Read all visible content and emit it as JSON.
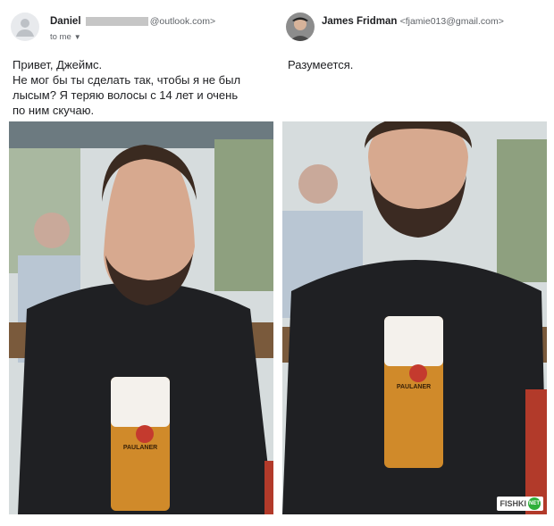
{
  "left": {
    "sender_name": "Daniel",
    "sender_email_domain": "@outlook.com>",
    "recipient": "to me",
    "message_lines": [
      "Привет, Джеймс.",
      "Не мог бы ты сделать так, чтобы я не был",
      "лысым? Я теряю волосы с 14 лет и очень",
      "по ним скучаю."
    ],
    "photo_text": "PAULANER"
  },
  "right": {
    "sender_name": "James Fridman",
    "sender_email": "<fjamie013@gmail.com>",
    "message": "Разумеется.",
    "photo_text": "PAULANER"
  },
  "watermark": {
    "text": "FISHKI",
    "badge": "NET",
    "color": "#2eaf3a"
  }
}
